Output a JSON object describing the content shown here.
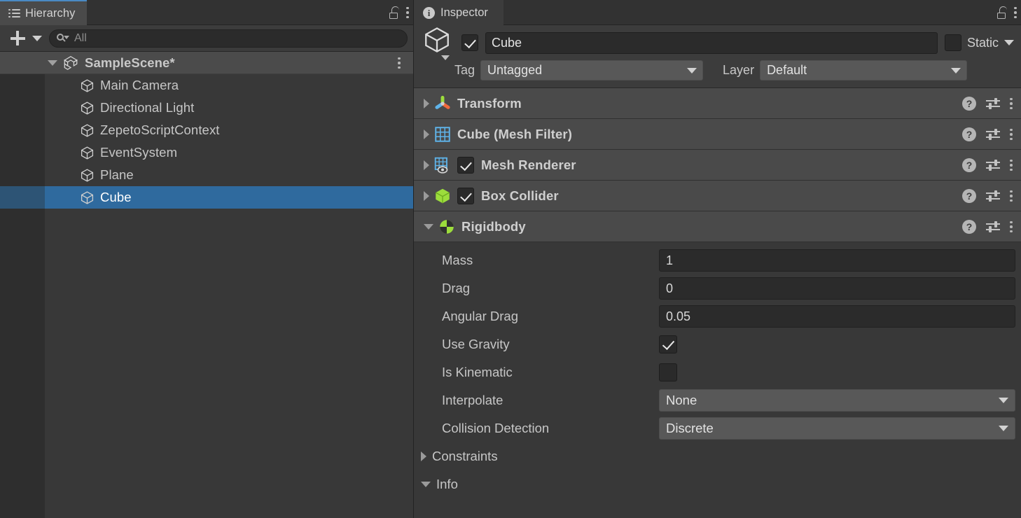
{
  "hierarchy": {
    "tab": {
      "label": "Hierarchy",
      "icon": "hierarchy-list-icon"
    },
    "lock_icon": "lock-open-icon",
    "menu_icon": "kebab-menu-icon",
    "toolbar": {
      "add_icon": "plus-icon",
      "add_dropdown_icon": "chevron-down-icon",
      "search_icon": "search-icon",
      "search_value": "",
      "search_placeholder": "All"
    },
    "scene": {
      "name": "SampleScene*",
      "icon": "unity-scene-icon",
      "expanded": true
    },
    "items": [
      {
        "label": "Main Camera",
        "icon": "gameobject-cube-icon",
        "selected": false
      },
      {
        "label": "Directional Light",
        "icon": "gameobject-cube-icon",
        "selected": false
      },
      {
        "label": "ZepetoScriptContext",
        "icon": "gameobject-cube-icon",
        "selected": false
      },
      {
        "label": "EventSystem",
        "icon": "gameobject-cube-icon",
        "selected": false
      },
      {
        "label": "Plane",
        "icon": "gameobject-cube-icon",
        "selected": false
      },
      {
        "label": "Cube",
        "icon": "gameobject-cube-icon",
        "selected": true
      }
    ]
  },
  "inspector": {
    "tab": {
      "label": "Inspector",
      "icon": "info-icon"
    },
    "lock_icon": "lock-open-icon",
    "menu_icon": "kebab-menu-icon",
    "object": {
      "icon": "cube-preview-icon",
      "enabled": true,
      "name": "Cube",
      "static_label": "Static",
      "static_checked": false,
      "tag_label": "Tag",
      "tag_value": "Untagged",
      "layer_label": "Layer",
      "layer_value": "Default"
    },
    "components": [
      {
        "title": "Transform",
        "icon": "transform-axis-icon",
        "expanded": false,
        "has_toggle": false
      },
      {
        "title": "Cube (Mesh Filter)",
        "icon": "mesh-filter-grid-icon",
        "expanded": false,
        "has_toggle": false
      },
      {
        "title": "Mesh Renderer",
        "icon": "mesh-renderer-icon",
        "expanded": false,
        "has_toggle": true,
        "enabled": true
      },
      {
        "title": "Box Collider",
        "icon": "box-collider-icon",
        "expanded": false,
        "has_toggle": true,
        "enabled": true
      },
      {
        "title": "Rigidbody",
        "icon": "rigidbody-icon",
        "expanded": true,
        "has_toggle": false
      }
    ],
    "component_actions": {
      "help_icon": "help-question-icon",
      "preset_icon": "preset-sliders-icon",
      "menu_icon": "kebab-menu-icon"
    },
    "rigidbody": {
      "properties": [
        {
          "label": "Mass",
          "type": "text",
          "value": "1"
        },
        {
          "label": "Drag",
          "type": "text",
          "value": "0"
        },
        {
          "label": "Angular Drag",
          "type": "text",
          "value": "0.05"
        },
        {
          "label": "Use Gravity",
          "type": "checkbox",
          "checked": true
        },
        {
          "label": "Is Kinematic",
          "type": "checkbox",
          "checked": false
        },
        {
          "label": "Interpolate",
          "type": "dropdown",
          "value": "None"
        },
        {
          "label": "Collision Detection",
          "type": "dropdown",
          "value": "Discrete"
        }
      ],
      "foldouts": [
        {
          "label": "Constraints",
          "expanded": false
        },
        {
          "label": "Info",
          "expanded": true
        }
      ]
    }
  },
  "colors": {
    "panel_bg": "#383838",
    "header_bg": "#4a4a4a",
    "tab_active": "#4a4a4a",
    "accent_selection": "#2f6a9e",
    "accent_tab_top": "#4a8ac4",
    "input_bg": "#2b2b2b",
    "dropdown_bg": "#585858",
    "collider_green": "#9cdd3c",
    "mesh_blue": "#5fb4ea"
  }
}
